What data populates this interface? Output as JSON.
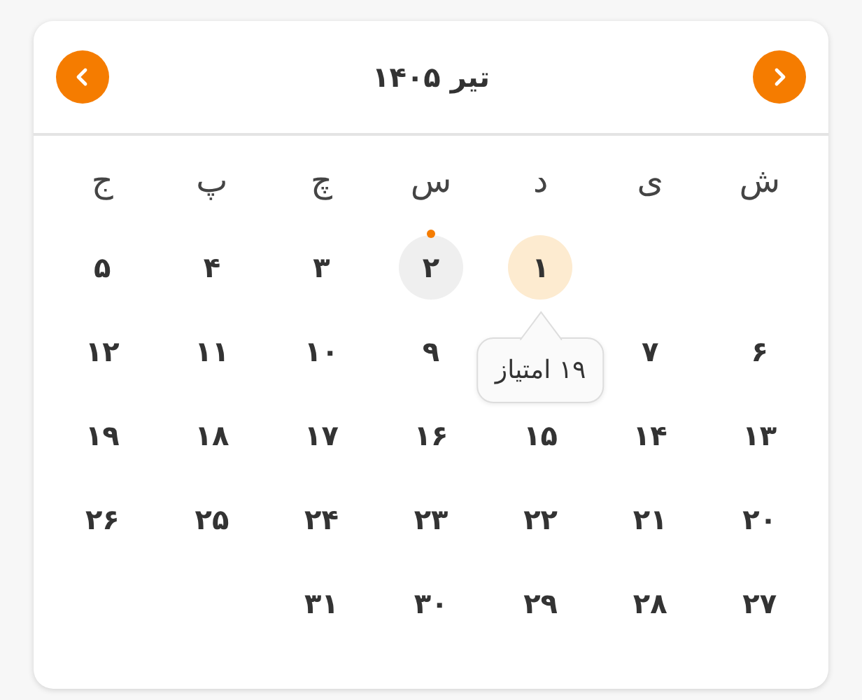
{
  "header": {
    "title": "تیر ۱۴۰۵"
  },
  "weekdays": [
    "ش",
    "ی",
    "د",
    "س",
    "چ",
    "پ",
    "ج"
  ],
  "weeks": [
    [
      {
        "kind": "blank"
      },
      {
        "kind": "blank"
      },
      {
        "kind": "day",
        "day": "۱",
        "selected": true,
        "today": false,
        "tooltip": "۱۹ امتیاز"
      },
      {
        "kind": "day",
        "day": "۲",
        "selected": false,
        "today": true
      },
      {
        "kind": "day",
        "day": "۳",
        "selected": false,
        "today": false
      },
      {
        "kind": "day",
        "day": "۴",
        "selected": false,
        "today": false
      },
      {
        "kind": "day",
        "day": "۵",
        "selected": false,
        "today": false
      }
    ],
    [
      {
        "kind": "day",
        "day": "۶",
        "selected": false,
        "today": false
      },
      {
        "kind": "day",
        "day": "۷",
        "selected": false,
        "today": false
      },
      {
        "kind": "blank"
      },
      {
        "kind": "day",
        "day": "۹",
        "selected": false,
        "today": false
      },
      {
        "kind": "day",
        "day": "۱۰",
        "selected": false,
        "today": false
      },
      {
        "kind": "day",
        "day": "۱۱",
        "selected": false,
        "today": false
      },
      {
        "kind": "day",
        "day": "۱۲",
        "selected": false,
        "today": false
      }
    ],
    [
      {
        "kind": "day",
        "day": "۱۳",
        "selected": false,
        "today": false
      },
      {
        "kind": "day",
        "day": "۱۴",
        "selected": false,
        "today": false
      },
      {
        "kind": "day",
        "day": "۱۵",
        "selected": false,
        "today": false
      },
      {
        "kind": "day",
        "day": "۱۶",
        "selected": false,
        "today": false
      },
      {
        "kind": "day",
        "day": "۱۷",
        "selected": false,
        "today": false
      },
      {
        "kind": "day",
        "day": "۱۸",
        "selected": false,
        "today": false
      },
      {
        "kind": "day",
        "day": "۱۹",
        "selected": false,
        "today": false
      }
    ],
    [
      {
        "kind": "day",
        "day": "۲۰",
        "selected": false,
        "today": false
      },
      {
        "kind": "day",
        "day": "۲۱",
        "selected": false,
        "today": false
      },
      {
        "kind": "day",
        "day": "۲۲",
        "selected": false,
        "today": false
      },
      {
        "kind": "day",
        "day": "۲۳",
        "selected": false,
        "today": false
      },
      {
        "kind": "day",
        "day": "۲۴",
        "selected": false,
        "today": false
      },
      {
        "kind": "day",
        "day": "۲۵",
        "selected": false,
        "today": false
      },
      {
        "kind": "day",
        "day": "۲۶",
        "selected": false,
        "today": false
      }
    ],
    [
      {
        "kind": "day",
        "day": "۲۷",
        "selected": false,
        "today": false
      },
      {
        "kind": "day",
        "day": "۲۸",
        "selected": false,
        "today": false
      },
      {
        "kind": "day",
        "day": "۲۹",
        "selected": false,
        "today": false
      },
      {
        "kind": "day",
        "day": "۳۰",
        "selected": false,
        "today": false
      },
      {
        "kind": "day",
        "day": "۳۱",
        "selected": false,
        "today": false
      },
      {
        "kind": "blank"
      },
      {
        "kind": "blank"
      }
    ]
  ]
}
